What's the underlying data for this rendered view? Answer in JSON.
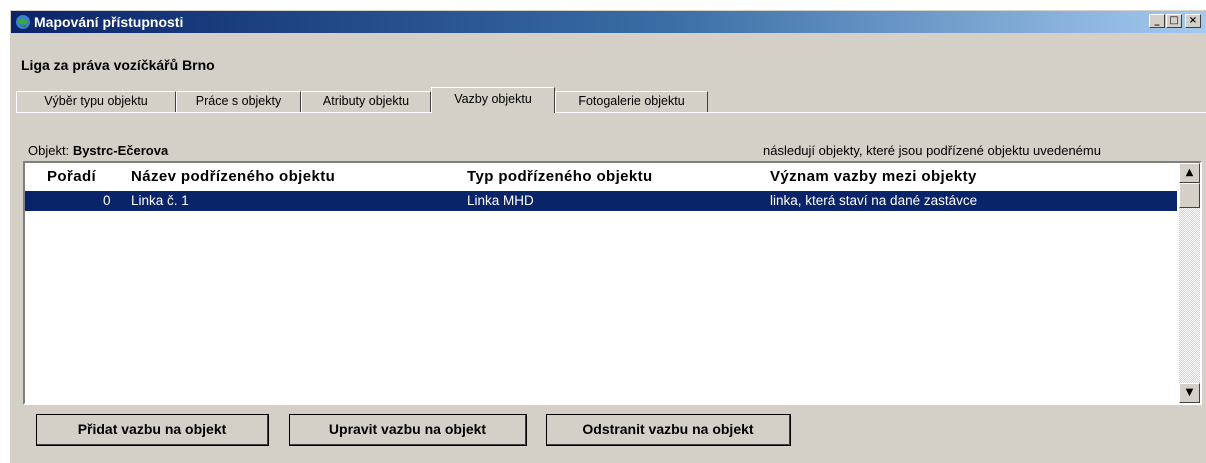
{
  "window": {
    "title": "Mapování přístupnosti",
    "controls": {
      "minimize": "_",
      "maximize": "□",
      "close": "×"
    }
  },
  "organization": "Liga za práva vozíčkářů Brno",
  "tabs": [
    {
      "label": "Výběr typu objektu",
      "active": false
    },
    {
      "label": "Práce s objekty",
      "active": false
    },
    {
      "label": "Atributy objektu",
      "active": false
    },
    {
      "label": "Vazby objektu",
      "active": true
    },
    {
      "label": "Fotogalerie objektu",
      "active": false
    }
  ],
  "object": {
    "label": "Objekt:",
    "name": "Bystrc-Ečerova",
    "hint": "následují objekty, které jsou podřízené objektu uvedenému"
  },
  "list": {
    "columns": [
      "Pořadí",
      "Název podřízeného objektu",
      "Typ podřízeného objektu",
      "Význam vazby mezi objekty"
    ],
    "rows": [
      {
        "order": "0",
        "name": "Linka č. 1",
        "type": "Linka MHD",
        "meaning": "linka, která staví na dané zastávce",
        "selected": true
      }
    ]
  },
  "buttons": {
    "add": "Přidat vazbu na objekt",
    "edit": "Upravit vazbu na objekt",
    "remove": "Odstranit vazbu na objekt"
  },
  "colors": {
    "title_start": "#0a246a",
    "title_end": "#a6caf0",
    "selection": "#0a246a",
    "face": "#d4d0c8"
  }
}
